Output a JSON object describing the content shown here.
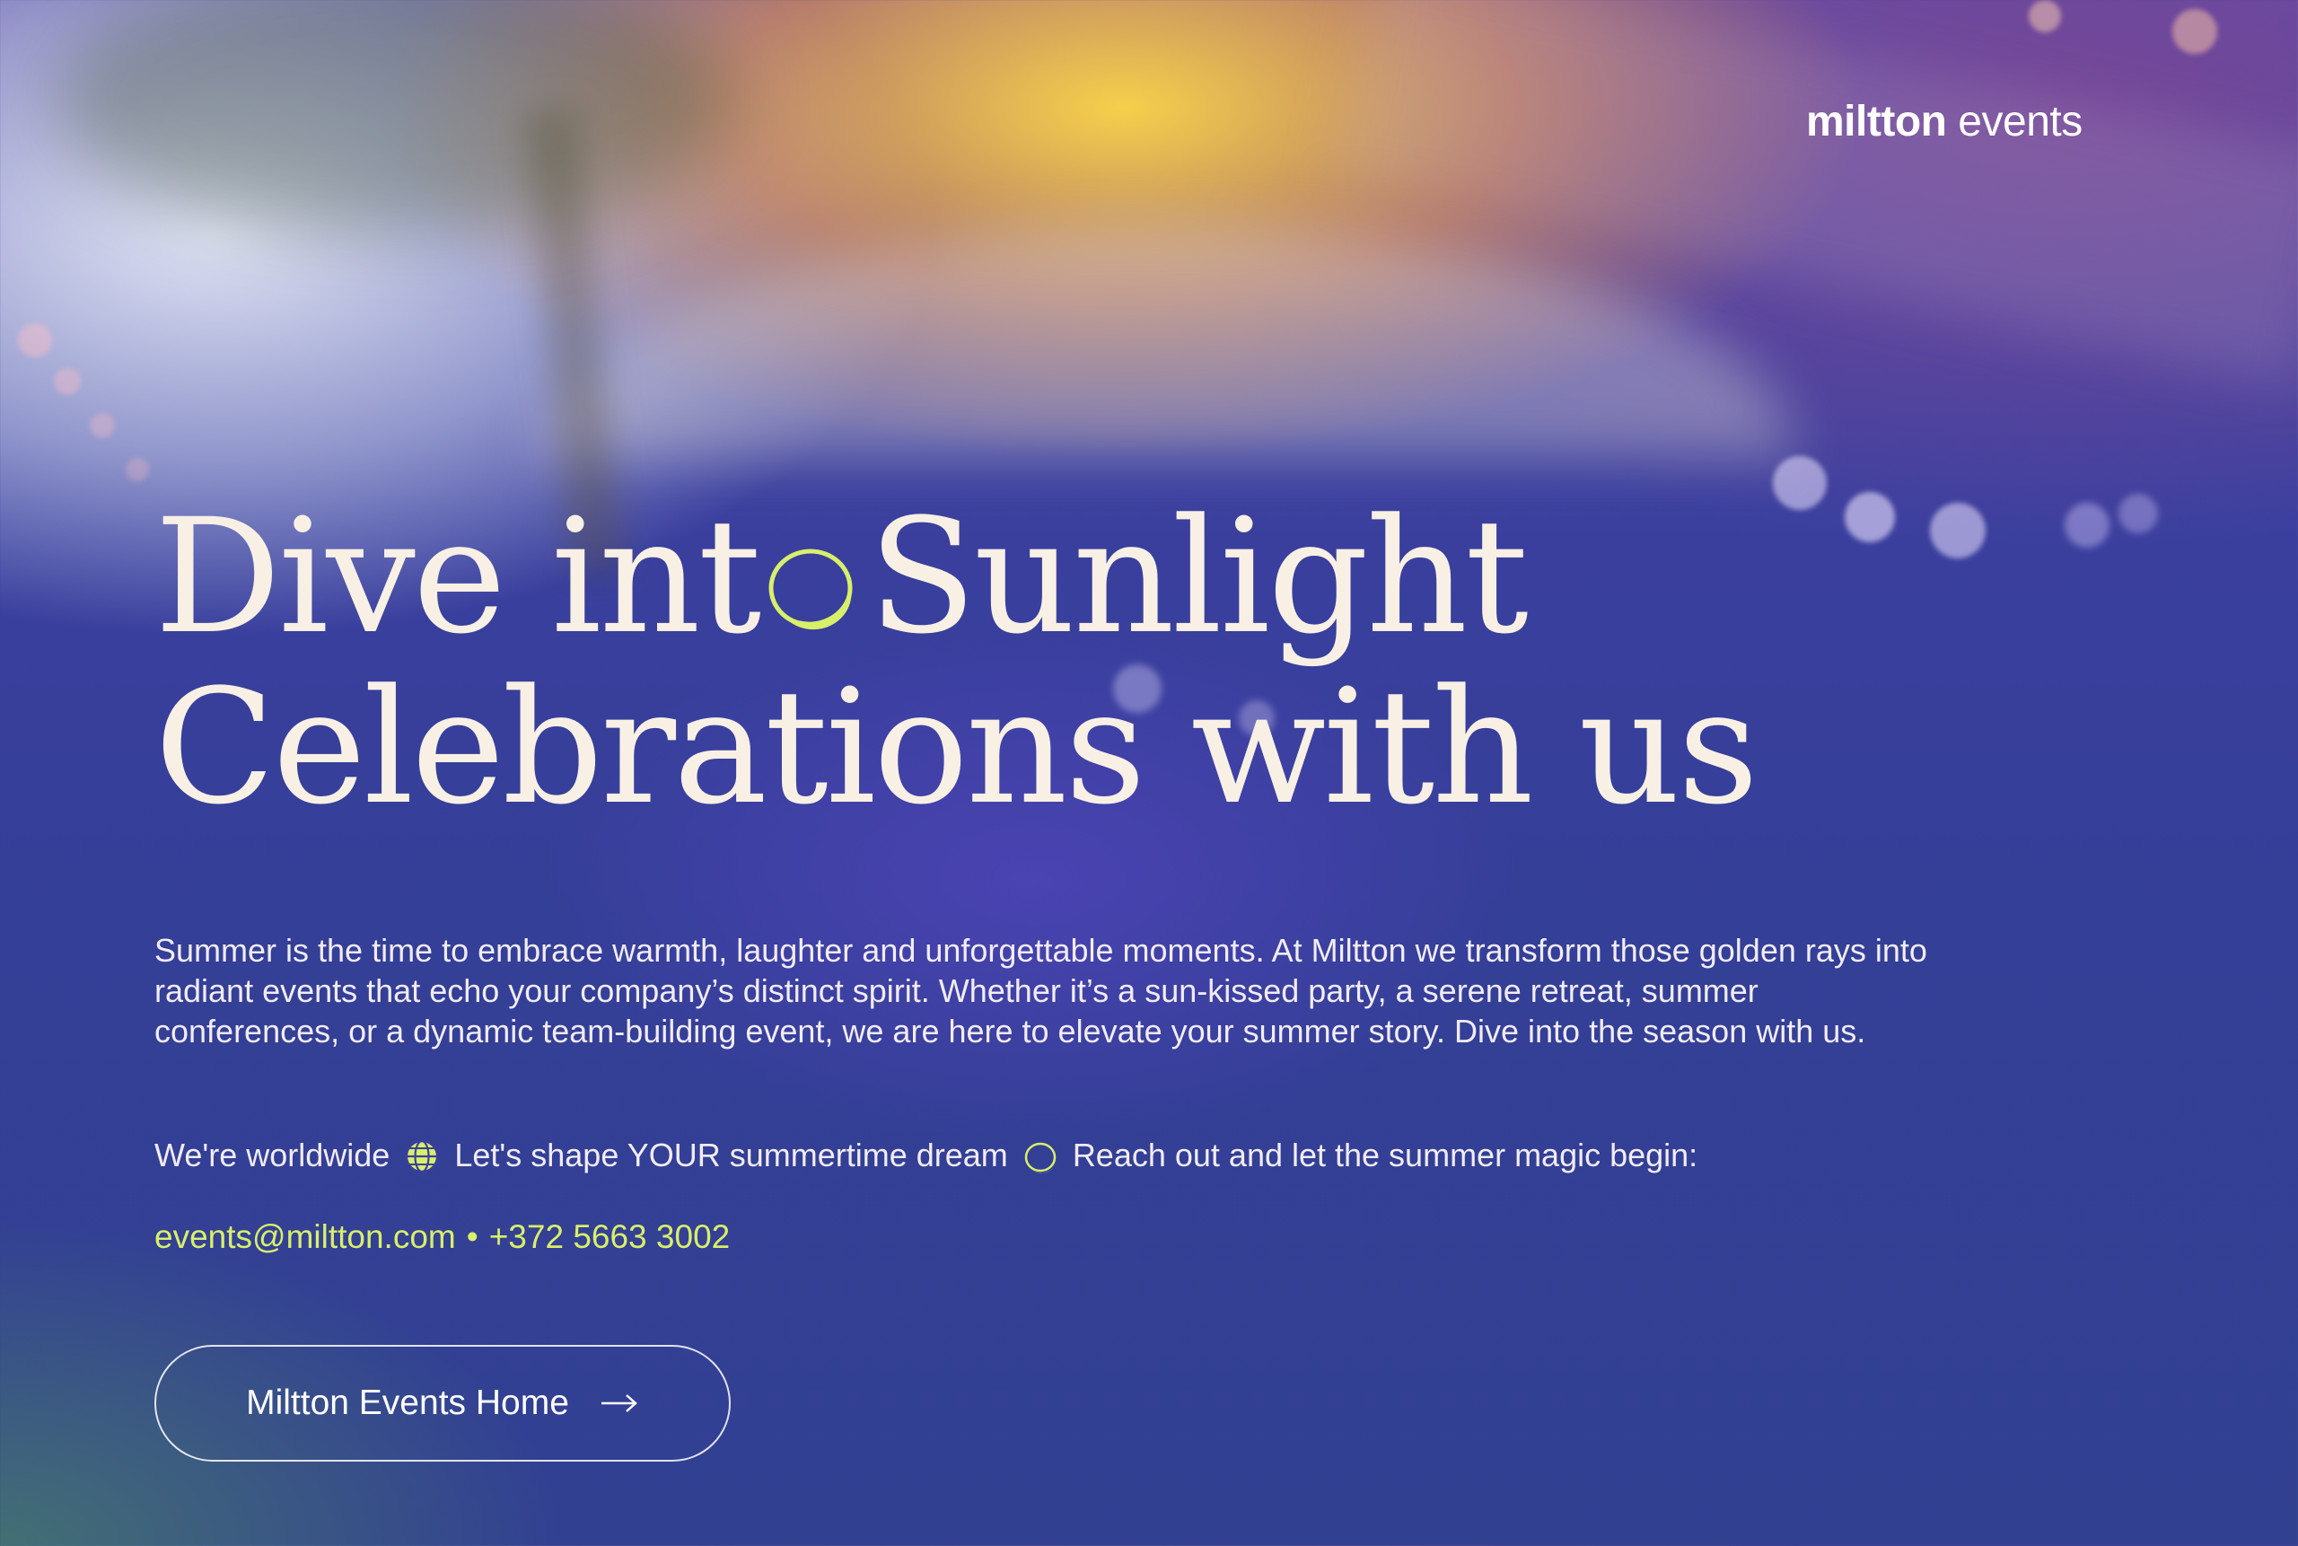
{
  "brand": {
    "bold": "miltton",
    "light": " events"
  },
  "headline": {
    "line1_part1": "Dive int",
    "line1_part2": "Sunlight",
    "line2": "Celebrations with us"
  },
  "intro": "Summer is the time to embrace warmth, laughter and unforgettable moments. At Miltton we transform those golden rays into radiant events that echo your company’s distinct spirit. Whether it’s a sun-kissed party, a serene retreat, summer conferences, or a dynamic team-building event, we are here to elevate your summer story. Dive into the season with us.",
  "cta": {
    "part1": "We're worldwide",
    "part2": "Let's shape YOUR summertime dream",
    "part3": "Reach out and let the summer magic begin:"
  },
  "contact": {
    "email": "events@miltton.com",
    "separator": "•",
    "phone": "+372 5663 3002"
  },
  "button": {
    "label": "Miltton Events Home"
  },
  "icons": {
    "globe": "globe-icon",
    "sun_ring": "sun-ring-icon",
    "arrow": "arrow-right-icon"
  },
  "colors": {
    "accent": "#d8ef6a",
    "headline": "#f8f0e4",
    "text": "#f1ecf4",
    "background": "#343f97"
  }
}
